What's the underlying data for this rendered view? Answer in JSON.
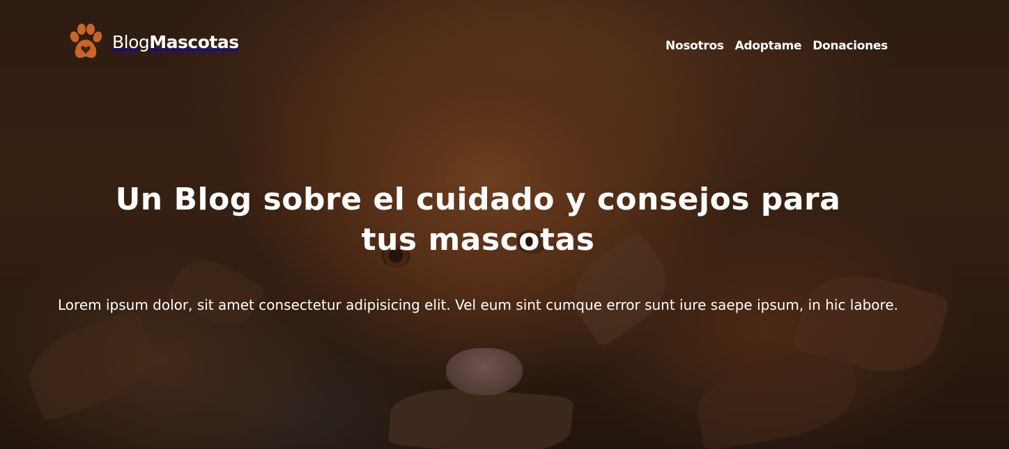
{
  "brand": {
    "name_regular": "Blog",
    "name_bold": "Mascotas",
    "accent_color": "#c9652b",
    "icon": "paw-icon"
  },
  "nav": {
    "items": [
      {
        "label": "Nosotros"
      },
      {
        "label": "Adoptame"
      },
      {
        "label": "Donaciones"
      }
    ]
  },
  "hero": {
    "title": "Un Blog sobre el cuidado y consejos para tus mascotas",
    "text": "Lorem ipsum dolor, sit amet consectetur adipisicing elit. Vel eum sint cumque error sunt iure saepe ipsum, in hic labore.",
    "background_image": "dog-lying-on-autumn-leaves"
  }
}
